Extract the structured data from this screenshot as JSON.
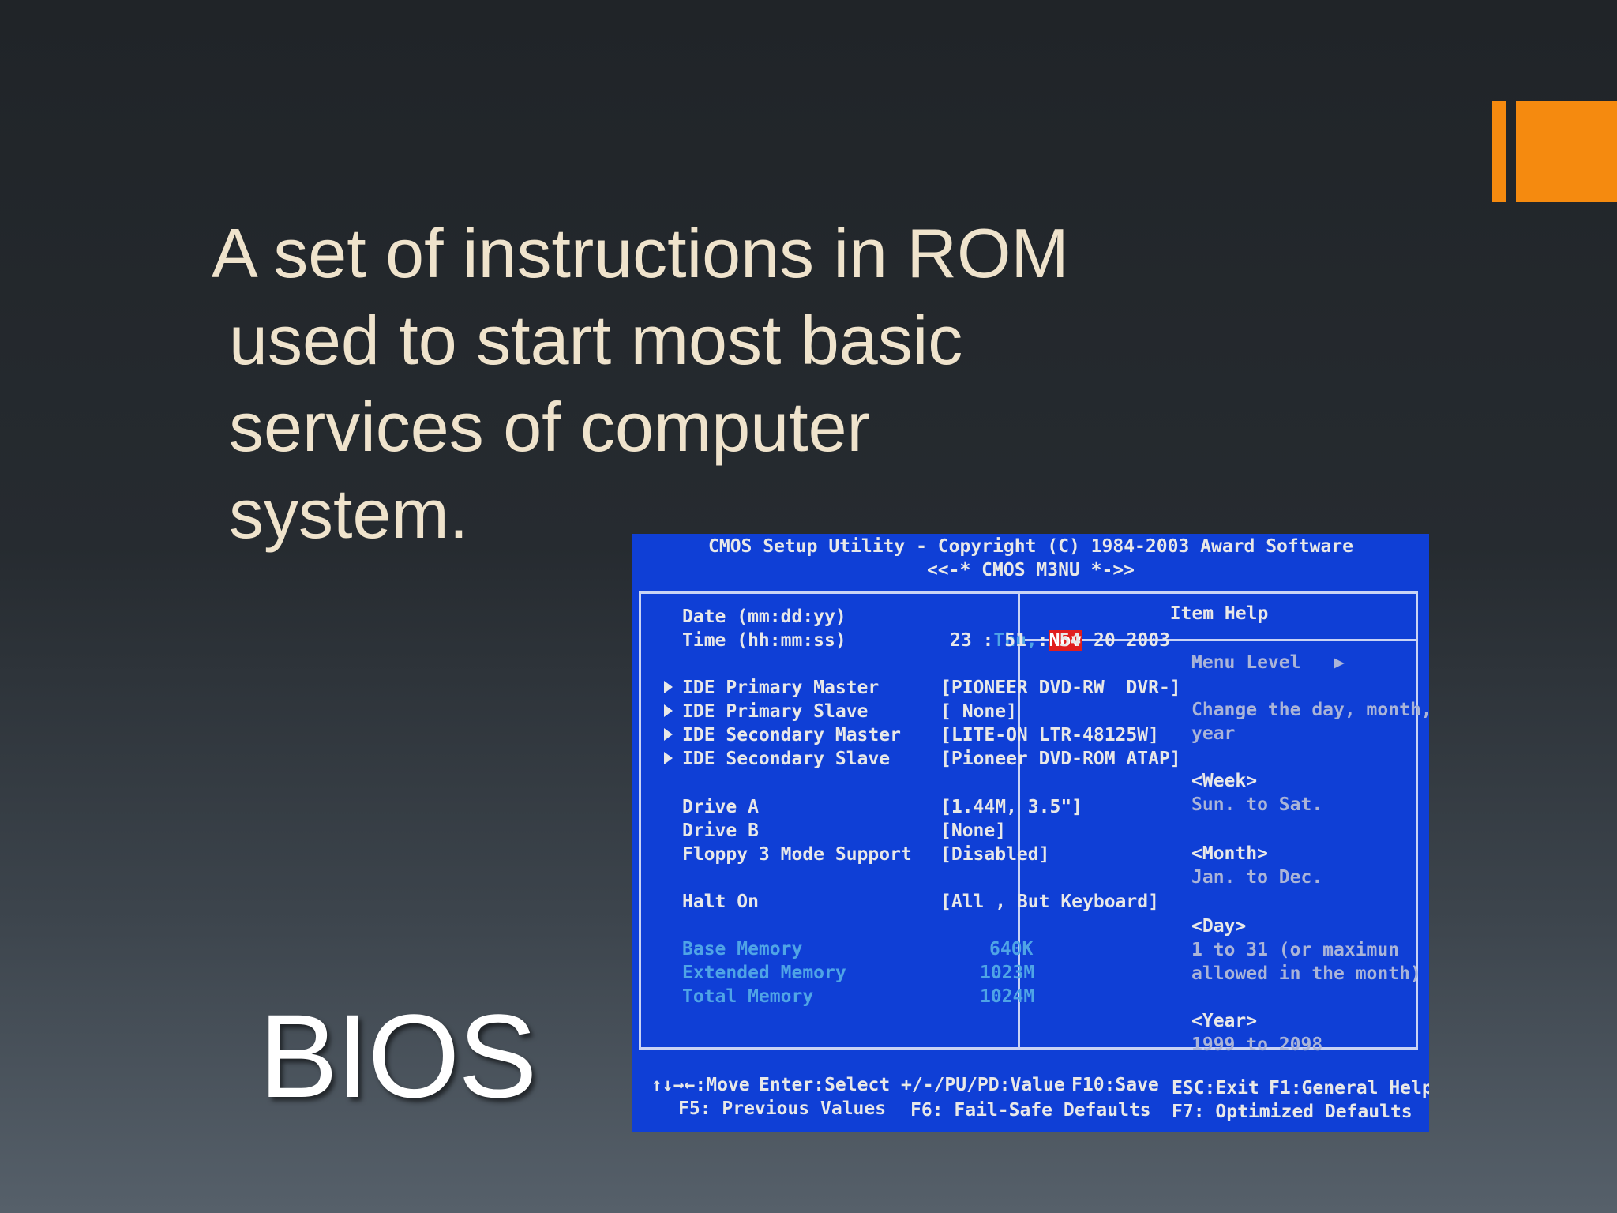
{
  "slide": {
    "body_lines": [
      "A set of instructions in ROM",
      "used to start most basic",
      "services of computer",
      "system."
    ],
    "title": "BIOS"
  },
  "bios": {
    "header_line1": "CMOS Setup Utility - Copyright (C) 1984-2003 Award Software",
    "header_line2": "<<-*  CMOS  M3NU  *->>",
    "rows": {
      "date": {
        "label": "Date (mm:dd:yy)",
        "day": "Thu,",
        "month": "Nov",
        "rest": "20 2003"
      },
      "time": {
        "label": "Time (hh:mm:ss)",
        "value": "23 : 51 : 54"
      },
      "ide_pm": {
        "label": "IDE Primary Master",
        "value": "[PIONEER DVD-RW  DVR-]"
      },
      "ide_ps": {
        "label": "IDE Primary Slave",
        "value": "[ None]"
      },
      "ide_sm": {
        "label": "IDE Secondary Master",
        "value": "[LITE-ON LTR-48125W]"
      },
      "ide_ss": {
        "label": "IDE Secondary Slave",
        "value": "[Pioneer DVD-ROM ATAP]"
      },
      "drive_a": {
        "label": "Drive A",
        "value": "[1.44M, 3.5\"]"
      },
      "drive_b": {
        "label": "Drive B",
        "value": "[None]"
      },
      "floppy": {
        "label": "Floppy 3 Mode Support",
        "value": "[Disabled]"
      },
      "halt": {
        "label": "Halt On",
        "value": "[All , But Keyboard]"
      },
      "base_mem": {
        "label": "Base Memory",
        "value": "640K"
      },
      "ext_mem": {
        "label": "Extended Memory",
        "value": "1023M"
      },
      "total_mem": {
        "label": "Total Memory",
        "value": "1024M"
      }
    },
    "help": {
      "title": "Item Help",
      "menu_level": "Menu Level   ▶",
      "desc1": "Change the day, month,",
      "desc2": "year",
      "week_h": "<Week>",
      "week_v": "Sun. to Sat.",
      "month_h": "<Month>",
      "month_v": "Jan. to Dec.",
      "day_h": "<Day>",
      "day_v1": "1 to 31 (or maximun",
      "day_v2": "allowed in the month)",
      "year_h": "<Year>",
      "year_v": "1999 to 2098"
    },
    "footer": {
      "move": "↑↓→←:Move",
      "enter": "Enter:Select",
      "value": "+/-/PU/PD:Value",
      "save": "F10:Save",
      "exit": "ESC:Exit",
      "help": "F1:General Help",
      "prev": "F5: Previous Values",
      "failsafe": "F6: Fail-Safe Defaults",
      "optimized": "F7: Optimized Defaults"
    }
  },
  "colors": {
    "accent": "#f58a0f",
    "bios_blue": "#0f3fd6",
    "highlight_red": "#e01e1e",
    "body_text": "#efe3cc"
  }
}
